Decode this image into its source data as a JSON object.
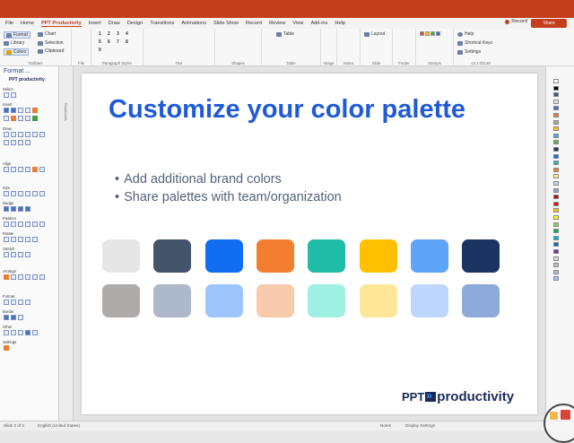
{
  "menu": {
    "tabs": [
      "File",
      "Home",
      "PPT Productivity",
      "Insert",
      "Draw",
      "Design",
      "Transitions",
      "Animations",
      "Slide Show",
      "Record",
      "Review",
      "View",
      "Add-ins",
      "Help"
    ],
    "active": "PPT Productivity",
    "record_label": "Record",
    "share_label": "Share"
  },
  "ribbon": {
    "toolbars": {
      "format": "Format",
      "library": "Library",
      "colors": "Colors",
      "chart": "Chart",
      "selection": "Selection",
      "clipboard": "Clipboard",
      "label": "Toolbars"
    },
    "file_label": "File",
    "paragraph_label": "Paragraph Styles",
    "text_label": "Text",
    "shapes_label": "Shapes",
    "table_label": "Table",
    "image_label": "Image",
    "notes_label": "Notes",
    "slide_label": "Slide",
    "footer_label": "Footer",
    "stamps_label": "Stamps",
    "table_btn": "Table",
    "layout_btn": "Layout",
    "help_btn": "Help",
    "shortcut_keys": "Shortcut Keys",
    "settings": "Settings",
    "version": "v3.1.03149",
    "num_col1": [
      "1",
      "5",
      "9"
    ],
    "num_col2": [
      "2",
      "6"
    ],
    "num_col3": [
      "3",
      "7"
    ],
    "num_col4": [
      "4",
      "8"
    ]
  },
  "left_panel": {
    "title": "Format ...",
    "logo": "PPT productivity",
    "sections": [
      "Select",
      "Insert",
      "Draw",
      "Align",
      "Size",
      "Nudge",
      "Position",
      "Rotate",
      "Stretch",
      "Arrange",
      "Format",
      "Border",
      "Other",
      "Settings"
    ]
  },
  "thumbnails_label": "Thumbnails",
  "slide": {
    "title": "Customize your color palette",
    "bullets": [
      "Add additional brand colors",
      "Share palettes with team/organization"
    ],
    "swatches_row1": [
      "#e6e6e6",
      "#44546a",
      "#0f6ef2",
      "#f47e30",
      "#1fbda7",
      "#ffc000",
      "#5ea4f8",
      "#1c3461"
    ],
    "swatches_row2": [
      "#afabab",
      "#adb9ca",
      "#9ec5fb",
      "#f8cbad",
      "#9ff0e3",
      "#ffe699",
      "#bdd7fb",
      "#8eaadb"
    ],
    "brand_ppt": "PPT",
    "brand_productivity": "productivity"
  },
  "status": {
    "slide_of": "Slide 2 of 2",
    "language": "English (United States)",
    "notes": "Notes",
    "display": "Display Settings"
  },
  "colors": {
    "accent": "#c43e1c",
    "title_blue": "#1f5bd6"
  }
}
